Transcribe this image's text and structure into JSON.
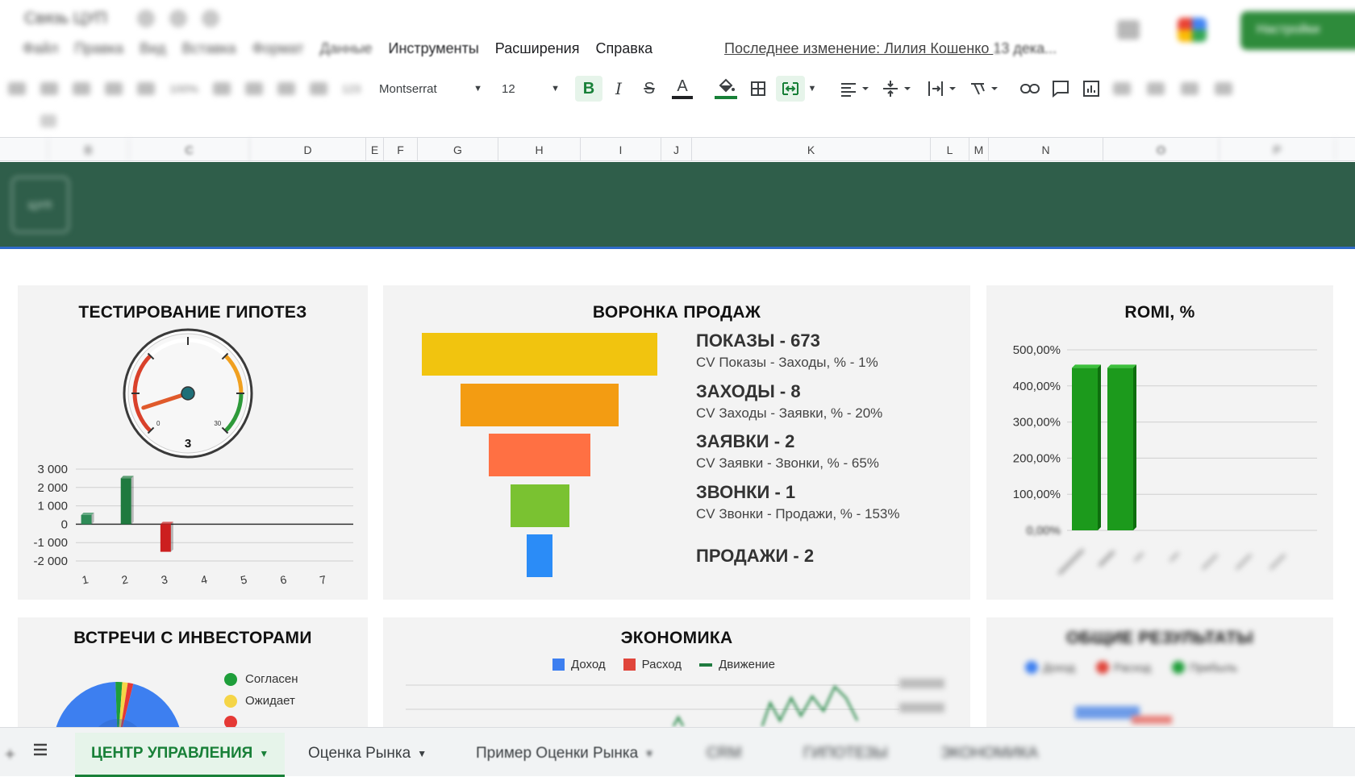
{
  "header": {
    "doc_title": "Связь ЦУП",
    "menu_blurred": [
      "Файл",
      "Правка",
      "Вид",
      "Вставка",
      "Формат",
      "Данные"
    ],
    "menu_clear": [
      "Инструменты",
      "Расширения",
      "Справка"
    ],
    "last_edit_visible": "Последнее изменение: Лилия Кошенко ",
    "last_edit_tail": "13 дека...",
    "share_label": "Настройки"
  },
  "toolbar": {
    "zoom": "100%",
    "number_format": "123",
    "font_family": "Montserrat",
    "font_size": "12",
    "bold": "B",
    "italic": "I",
    "strike": "S",
    "text_color": "A",
    "text_color_value": "#202124",
    "fill_color_value": "#188038"
  },
  "columns": [
    "B",
    "C",
    "D",
    "E",
    "F",
    "G",
    "H",
    "I",
    "J",
    "K",
    "L",
    "M",
    "N",
    "O",
    "P"
  ],
  "banner": {
    "logo": "ЦУП",
    "color": "#2f5e4a"
  },
  "hypotheses": {
    "title": "ТЕСТИРОВАНИЕ ГИПОТЕЗ",
    "gauge": {
      "value": 3,
      "min": 0,
      "max": 30,
      "value_label": "3",
      "min_label": "0",
      "max_label": "30"
    },
    "chart_data": {
      "type": "bar",
      "categories": [
        "1",
        "2",
        "3",
        "4",
        "5",
        "6",
        "7"
      ],
      "values": [
        500,
        2500,
        -1500,
        0,
        0,
        0,
        0
      ],
      "colors": [
        "#2e8b57",
        "#1f7a3f",
        "#cc1f1f",
        "#2e8b57",
        "#2e8b57",
        "#2e8b57",
        "#2e8b57"
      ],
      "ylim": [
        -2000,
        3000
      ],
      "yticks": [
        "3 000",
        "2 000",
        "1 000",
        "0",
        "-1 000",
        "-2 000"
      ],
      "ytick_values": [
        3000,
        2000,
        1000,
        0,
        -1000,
        -2000
      ],
      "grid": true
    }
  },
  "funnel": {
    "title": "ВОРОНКА ПРОДАЖ",
    "stages": [
      {
        "name": "ПОКАЗЫ - 673",
        "cv": "CV Показы - Заходы, % - 1%",
        "color": "#f1c40f",
        "width_fraction": 1.0
      },
      {
        "name": "ЗАХОДЫ - 8",
        "cv": "CV Заходы - Заявки, % - 20%",
        "color": "#f39c12",
        "width_fraction": 0.67
      },
      {
        "name": "ЗАЯВКИ - 2",
        "cv": "CV Заявки - Звонки, % - 65%",
        "color": "#ff7043",
        "width_fraction": 0.43
      },
      {
        "name": "ЗВОНКИ - 1",
        "cv": "CV Звонки - Продажи, % - 153%",
        "color": "#7ac231",
        "width_fraction": 0.25
      },
      {
        "name": "ПРОДАЖИ - 2",
        "cv": "",
        "color": "#2b8cf7",
        "width_fraction": 0.11
      }
    ]
  },
  "romi": {
    "title": "ROMI, %",
    "chart_data": {
      "type": "bar",
      "values": [
        450,
        450,
        0,
        0,
        0,
        0,
        0
      ],
      "ylim": [
        0,
        500
      ],
      "yticks": [
        "500,00%",
        "400,00%",
        "300,00%",
        "200,00%",
        "100,00%",
        "0,00%"
      ],
      "ytick_values": [
        500,
        400,
        300,
        200,
        100,
        0
      ],
      "color": "#1c9a1c",
      "grid": true
    }
  },
  "investors": {
    "title": "ВСТРЕЧИ С ИНВЕСТОРАМИ",
    "legend": [
      {
        "label": "Согласен",
        "color": "#1e9e3a"
      },
      {
        "label": "Ожидает",
        "color": "#f5d547"
      },
      {
        "label": "",
        "color": "#e53935"
      }
    ]
  },
  "economy": {
    "title": "ЭКОНОМИКА",
    "legend": [
      {
        "label": "Доход",
        "color": "#3d7ff0",
        "kind": "square"
      },
      {
        "label": "Расход",
        "color": "#e0453b",
        "kind": "square"
      },
      {
        "label": "Движение",
        "color": "#1f7a3f",
        "kind": "line"
      }
    ]
  },
  "results": {
    "title": "ОБЩИЕ РЕЗУЛЬТАТЫ",
    "legend": [
      "Доход",
      "Расход",
      "Прибыль"
    ]
  },
  "tabs": [
    {
      "label": "ЦЕНТР УПРАВЛЕНИЯ",
      "active": true
    },
    {
      "label": "Оценка Рынка",
      "active": false
    },
    {
      "label": "Пример Оценки Рынка",
      "active": false
    },
    {
      "label": "CRM",
      "active": false
    },
    {
      "label": "ГИПОТЕЗЫ",
      "active": false
    },
    {
      "label": "ЭКОНОМИКА",
      "active": false
    }
  ]
}
